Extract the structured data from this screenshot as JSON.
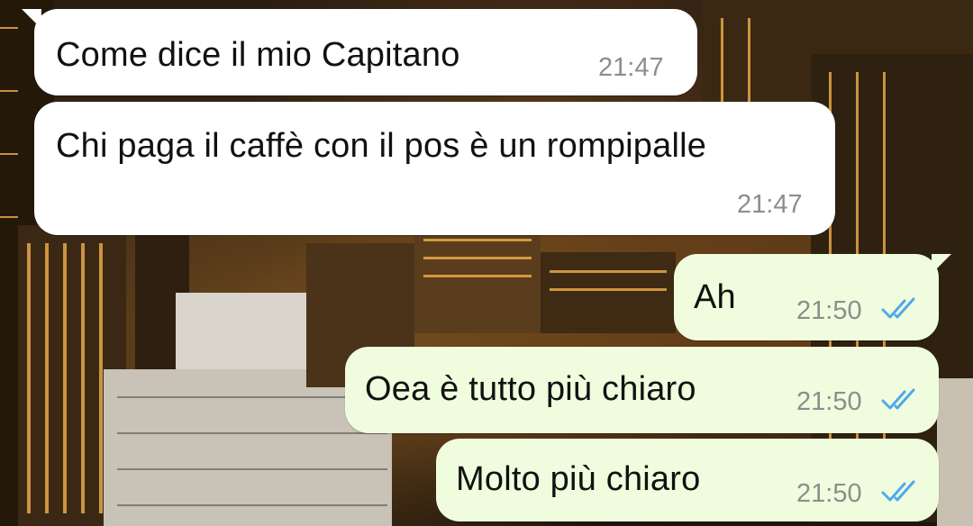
{
  "messages": [
    {
      "direction": "incoming",
      "text": "Come dice il mio Capitano",
      "time": "21:47"
    },
    {
      "direction": "incoming",
      "text": "Chi paga il caffè con il pos è un rompipalle",
      "time": "21:47"
    },
    {
      "direction": "outgoing",
      "text": "Ah",
      "time": "21:50",
      "status": "read-double-check-icon"
    },
    {
      "direction": "outgoing",
      "text": "Oea è tutto più chiaro",
      "time": "21:50",
      "status": "read-double-check-icon"
    },
    {
      "direction": "outgoing",
      "text": "Molto più chiaro",
      "time": "21:50",
      "status": "read-double-check-icon"
    }
  ],
  "colors": {
    "incoming_bubble": "#ffffff",
    "outgoing_bubble": "#effdde",
    "read_ticks": "#4fa9e8",
    "wallpaper": "#2b1c10"
  }
}
